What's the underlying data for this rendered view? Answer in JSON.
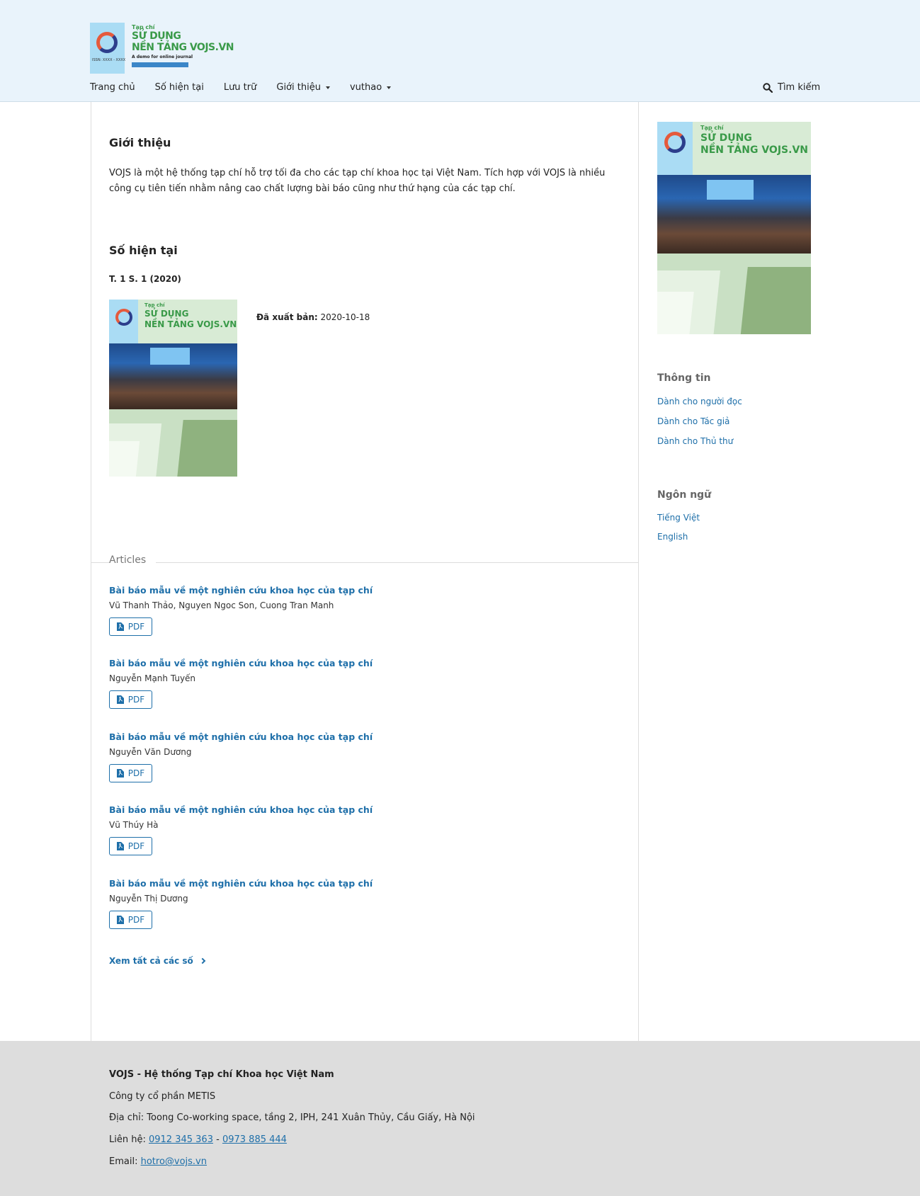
{
  "header": {
    "logo": {
      "small": "Tạp chí",
      "line1": "SỬ DỤNG",
      "line2": "NỀN TẢNG VOJS.VN",
      "demo": "A demo for online journal",
      "issn": "ISSN: XXXX - XXXX"
    },
    "nav": [
      {
        "label": "Trang chủ",
        "dropdown": false
      },
      {
        "label": "Số hiện tại",
        "dropdown": false
      },
      {
        "label": "Lưu trữ",
        "dropdown": false
      },
      {
        "label": "Giới thiệu",
        "dropdown": true
      },
      {
        "label": "vuthao",
        "dropdown": true
      }
    ],
    "search_label": "Tìm kiếm"
  },
  "main": {
    "about_heading": "Giới thiệu",
    "about_text": "VOJS là một hệ thống tạp chí hỗ trợ tối đa cho các tạp chí khoa học tại Việt Nam. Tích hợp với VOJS là nhiều công cụ tiên tiến nhằm nâng cao chất lượng bài báo cũng như thứ hạng của các tạp chí.",
    "current_heading": "Số hiện tại",
    "issue_identification": "T. 1 S. 1 (2020)",
    "published_label": "Đã xuất bản:",
    "published_date": "2020-10-18",
    "articles_heading": "Articles",
    "articles": [
      {
        "title": "Bài báo mẫu về một nghiên cứu khoa học của tạp chí",
        "authors": "Vũ Thanh Thảo, Nguyen Ngoc Son, Cuong Tran Manh",
        "galley": "PDF"
      },
      {
        "title": "Bài báo mẫu về một nghiên cứu khoa học của tạp chí",
        "authors": "Nguyễn Mạnh Tuyến",
        "galley": "PDF"
      },
      {
        "title": "Bài báo mẫu về một nghiên cứu khoa học của tạp chí",
        "authors": "Nguyễn Văn Dương",
        "galley": "PDF"
      },
      {
        "title": "Bài báo mẫu về một nghiên cứu khoa học của tạp chí",
        "authors": "Vũ Thúy Hà",
        "galley": "PDF"
      },
      {
        "title": "Bài báo mẫu về một nghiên cứu khoa học của tạp chí",
        "authors": "Nguyễn Thị Dương",
        "galley": "PDF"
      }
    ],
    "view_all": "Xem tất cả các số"
  },
  "sidebar": {
    "info_heading": "Thông tin",
    "info_links": [
      "Dành cho người đọc",
      "Dành cho Tác giả",
      "Dành cho Thủ thư"
    ],
    "language_heading": "Ngôn ngữ",
    "languages": [
      "Tiếng Việt",
      "English"
    ]
  },
  "footer": {
    "title": "VOJS - Hệ thống Tạp chí Khoa học Việt Nam",
    "company": "Công ty cổ phần METIS",
    "address": "Địa chỉ: Toong Co-working space, tầng 2, IPH, 241 Xuân Thủy, Cầu Giấy, Hà Nội",
    "contact_label": "Liên hệ:",
    "phone1": "0912 345 363",
    "phone_sep": "-",
    "phone2": "0973 885 444",
    "email_label": "Email:",
    "email": "hotro@vojs.vn"
  },
  "colors": {
    "link": "#1e6fa9",
    "header_bg": "#e9f3fb",
    "footer_bg": "#dddddd",
    "brand_green": "#3a9a49"
  }
}
